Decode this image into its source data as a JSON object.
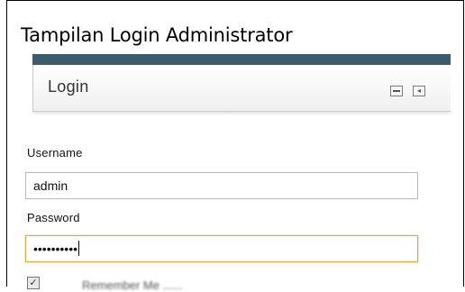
{
  "caption": "Tampilan Login Administrator",
  "window": {
    "title": "Login",
    "minimize_glyph": "",
    "collapse_glyph": "◂",
    "icons": [
      "minimize-icon",
      "collapse-icon"
    ]
  },
  "form": {
    "username_label": "Username",
    "username_value": "admin",
    "password_label": "Password",
    "password_value": "••••••••••",
    "remember_glyph": "✓",
    "remember_label": "Remember Me ......"
  },
  "colors": {
    "topbar": "#3e5b6c",
    "focus_border": "#e0a640",
    "field_border": "#b6b6b6"
  }
}
